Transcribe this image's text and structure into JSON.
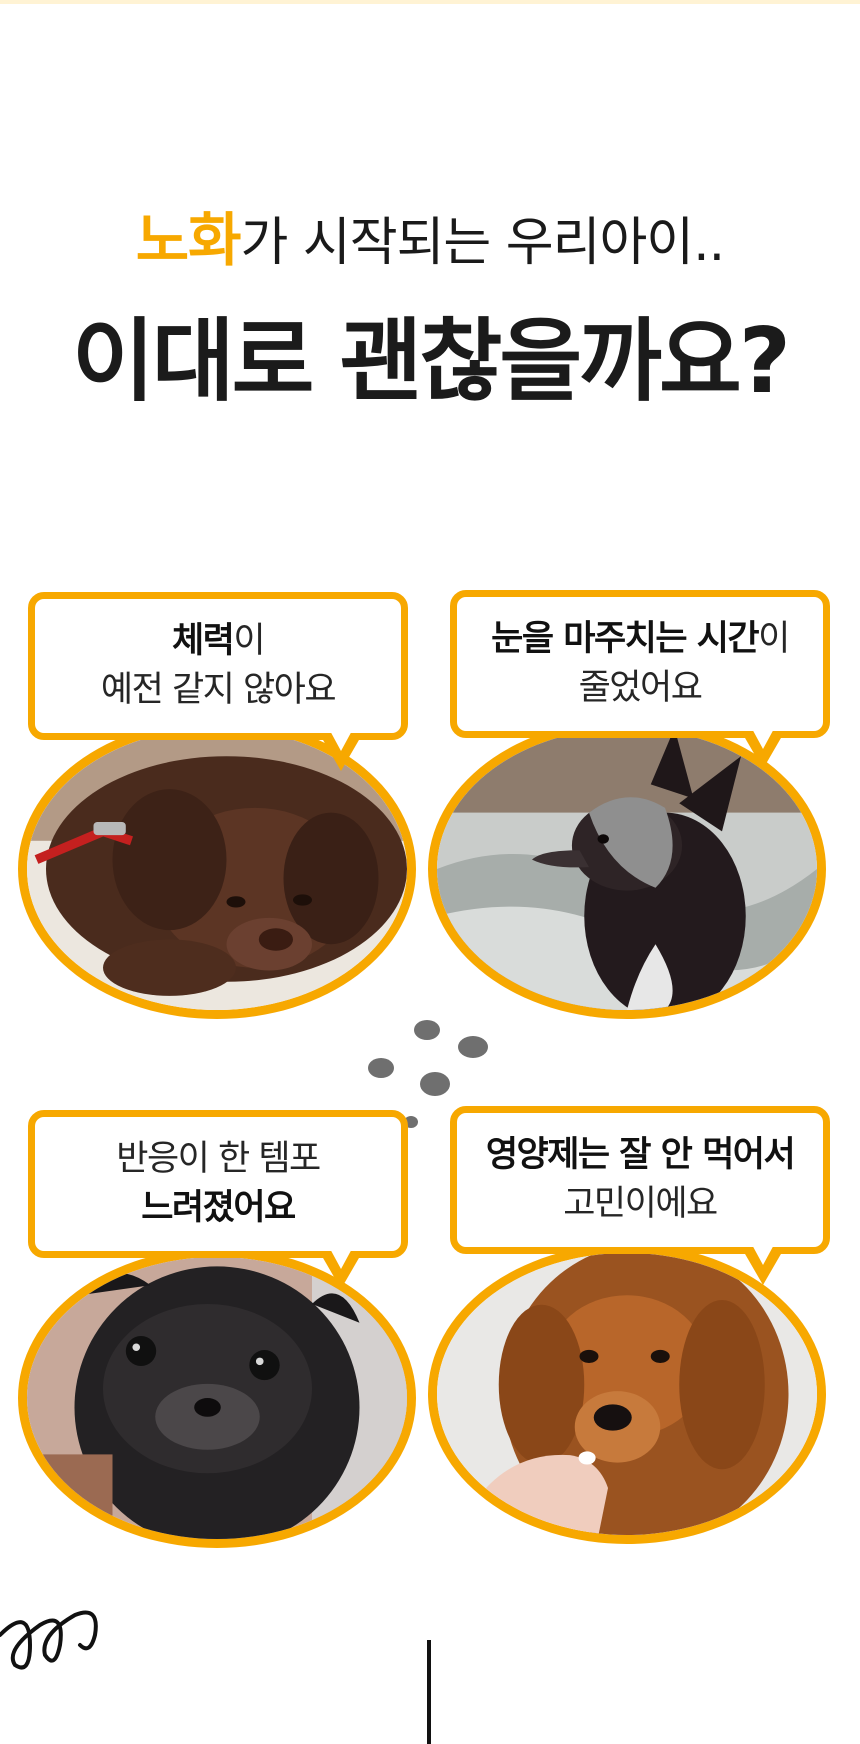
{
  "headline": {
    "line1_accent": "노화",
    "line1_rest": "가 시작되는 우리아이..",
    "line2": "이대로 괜찮을까요?"
  },
  "cards": [
    {
      "bold1": "체력",
      "text1": "이",
      "line2": "예전 같지 않아요",
      "image": "chocolate-labrador-resting"
    },
    {
      "bold1": "눈을 마주치는 시간",
      "text1": "이",
      "line2": "줄었어요",
      "image": "chinese-crested-dog-on-blanket"
    },
    {
      "line1": "반응이 한 템포",
      "bold2": "느려졌어요",
      "image": "black-pug-senior"
    },
    {
      "bold1": "영양제는 잘 안 먹어서",
      "line2": "고민이에요",
      "image": "golden-dog-sniffing-pill"
    }
  ],
  "colors": {
    "accent": "#f7a800",
    "text": "#1b1b1b",
    "background": "#ffffff"
  }
}
